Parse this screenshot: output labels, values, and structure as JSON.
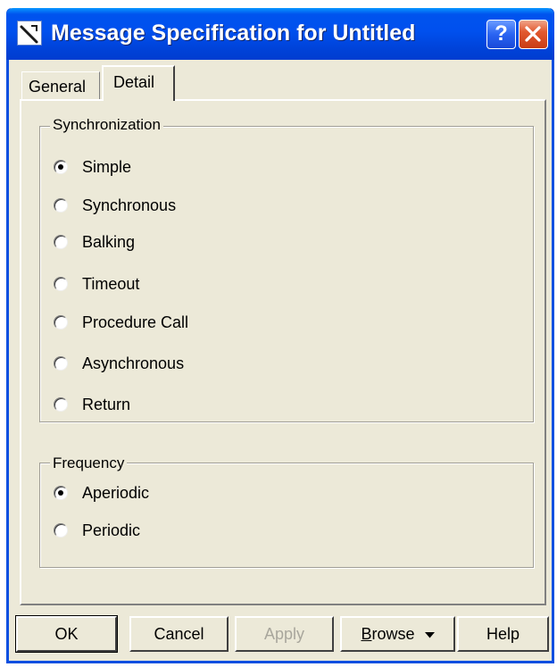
{
  "window": {
    "title": "Message Specification for Untitled",
    "help_glyph": "?"
  },
  "tabs": [
    {
      "label": "General",
      "active": false
    },
    {
      "label": "Detail",
      "active": true
    }
  ],
  "synchronization": {
    "legend": "Synchronization",
    "options": [
      {
        "label": "Simple",
        "selected": true
      },
      {
        "label": "Synchronous",
        "selected": false
      },
      {
        "label": "Balking",
        "selected": false
      },
      {
        "label": "Timeout",
        "selected": false
      },
      {
        "label": "Procedure Call",
        "selected": false
      },
      {
        "label": "Asynchronous",
        "selected": false
      },
      {
        "label": "Return",
        "selected": false
      }
    ]
  },
  "frequency": {
    "legend": "Frequency",
    "options": [
      {
        "label": "Aperiodic",
        "selected": true
      },
      {
        "label": "Periodic",
        "selected": false
      }
    ]
  },
  "buttons": {
    "ok": "OK",
    "cancel": "Cancel",
    "apply": "Apply",
    "browse_underlined": "B",
    "browse_rest": "rowse",
    "help": "Help"
  },
  "colors": {
    "titlebar": "#0053ee",
    "dialog_bg": "#ece9d8",
    "disabled_text": "#a8a69c"
  },
  "icons": {
    "title_icon": "message-spec-icon",
    "browse_dropdown": "caret-down-icon"
  }
}
